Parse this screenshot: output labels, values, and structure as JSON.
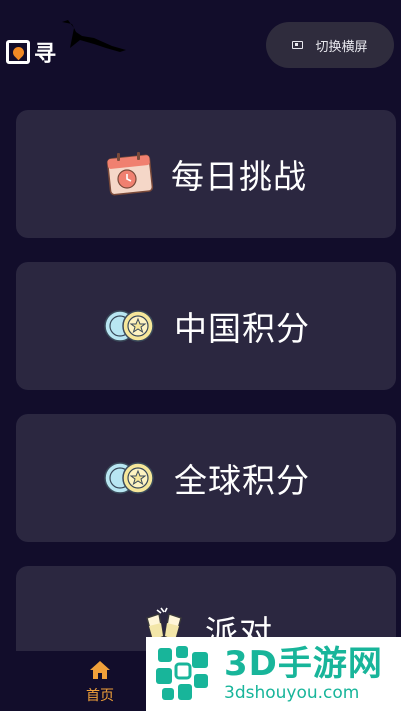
{
  "header": {
    "logo_text": "寻",
    "rotate_button_label": "切换横屏",
    "rotate_icon": "screen-rotate-icon"
  },
  "cards": [
    {
      "label": "每日挑战",
      "icon": "calendar-icon"
    },
    {
      "label": "中国积分",
      "icon": "coins-icon"
    },
    {
      "label": "全球积分",
      "icon": "coins-icon"
    },
    {
      "label": "派对",
      "icon": "cheers-icon"
    }
  ],
  "bottom_nav": {
    "home_label": "首页",
    "home_icon": "home-icon",
    "active_color": "#f0a03a"
  },
  "watermark": {
    "title": "3D手游网",
    "url": "3dshouyou.com"
  },
  "colors": {
    "background": "#120d2b",
    "card": "#2b2740",
    "accent": "#f0a03a",
    "watermark": "#18b59a"
  }
}
